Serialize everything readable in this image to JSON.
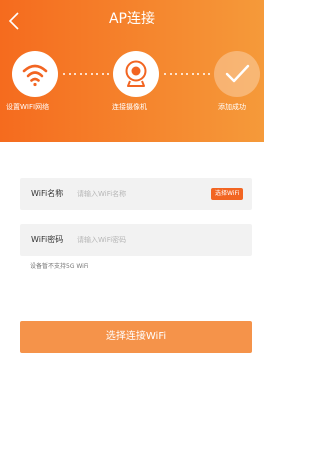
{
  "header": {
    "title": "AP连接",
    "back_icon": "chevron-left-icon",
    "background_start": "#f56b1e",
    "background_end": "#f59a3a"
  },
  "steps": [
    {
      "label": "设置WIFI网络",
      "icon": "wifi-icon",
      "state": "active"
    },
    {
      "label": "连接摄像机",
      "icon": "camera-icon",
      "state": "active"
    },
    {
      "label": "添加成功",
      "icon": "checkmark-icon",
      "state": "inactive"
    }
  ],
  "form": {
    "wifi_name": {
      "label": "WiFi名称",
      "placeholder": "请输入WiFi名称",
      "value": ""
    },
    "select_wifi_label": "选择WiFi",
    "wifi_password": {
      "label": "WiFi密码",
      "placeholder": "请输入WiFi密码",
      "value": ""
    },
    "hint": "设备暂不支持5G WiFi"
  },
  "primary_button": {
    "label": "选择连接WiFi",
    "color": "#f5934a"
  },
  "accent_color": "#f26522"
}
